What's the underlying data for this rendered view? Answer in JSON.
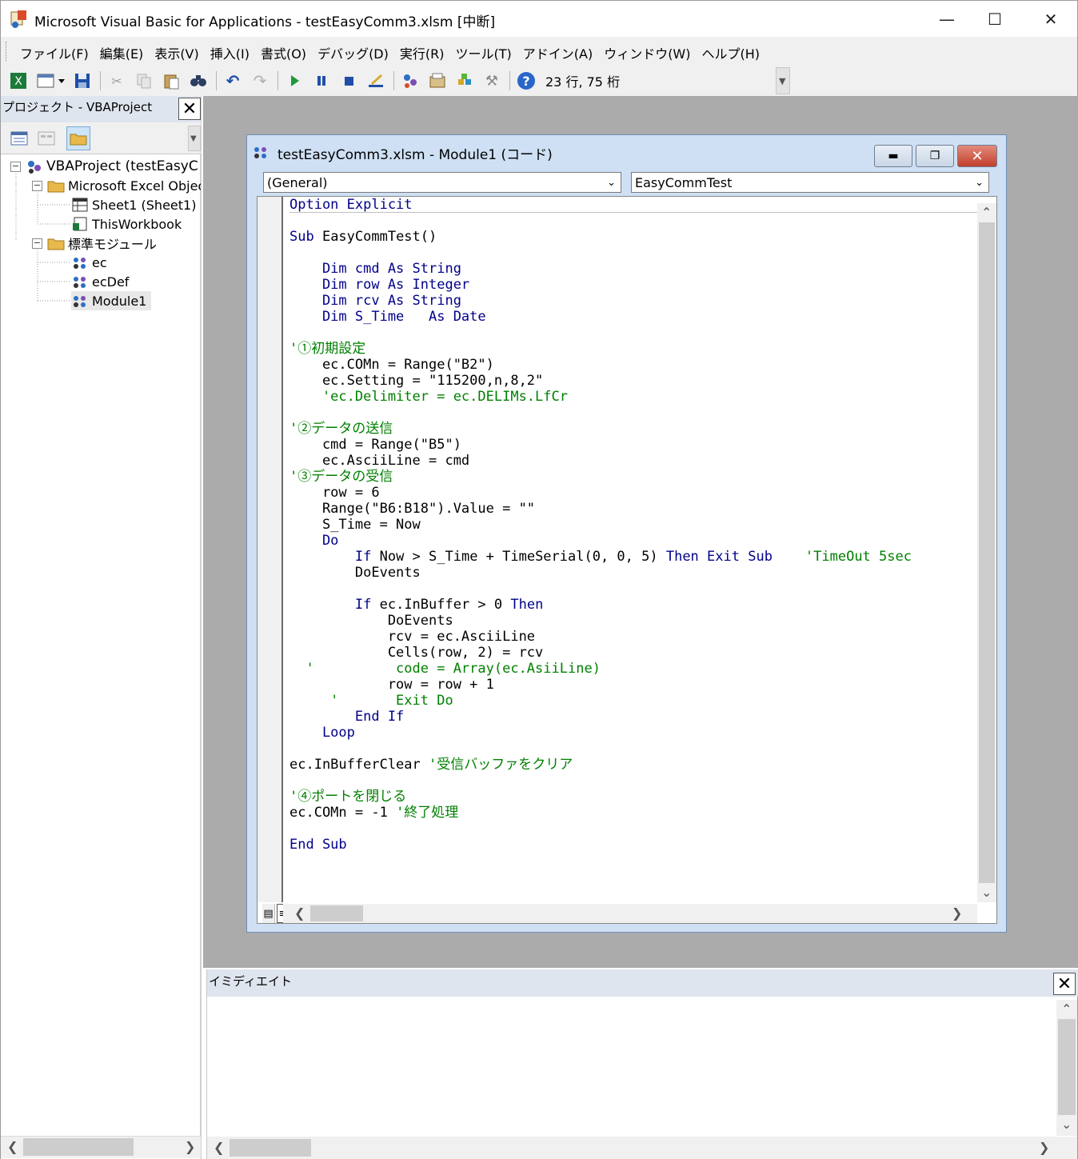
{
  "window": {
    "title": "Microsoft Visual Basic for Applications - testEasyComm3.xlsm [中断]",
    "minimize_icon": "minimize-icon",
    "maximize_icon": "maximize-icon",
    "close_icon": "close-icon"
  },
  "menubar": {
    "items": [
      {
        "label": "ファイル(F)"
      },
      {
        "label": "編集(E)"
      },
      {
        "label": "表示(V)"
      },
      {
        "label": "挿入(I)"
      },
      {
        "label": "書式(O)"
      },
      {
        "label": "デバッグ(D)"
      },
      {
        "label": "実行(R)"
      },
      {
        "label": "ツール(T)"
      },
      {
        "label": "アドイン(A)"
      },
      {
        "label": "ウィンドウ(W)"
      },
      {
        "label": "ヘルプ(H)"
      }
    ]
  },
  "toolbar": {
    "icons": [
      "excel-view-icon",
      "insert-module-icon",
      "save-icon",
      "cut-icon",
      "copy-icon",
      "paste-icon",
      "find-icon",
      "undo-icon",
      "redo-icon",
      "run-icon",
      "break-icon",
      "reset-icon",
      "design-mode-icon",
      "project-explorer-icon",
      "properties-icon",
      "object-browser-icon",
      "toolbox-icon",
      "help-icon"
    ],
    "cursor_position": "23 行, 75 桁"
  },
  "project": {
    "title": "プロジェクト - VBAProject",
    "tree": {
      "root": "VBAProject (testEasyC",
      "excel_objects": "Microsoft Excel Objec",
      "sheet1": "Sheet1 (Sheet1)",
      "thisworkbook": "ThisWorkbook",
      "modules_folder": "標準モジュール",
      "modules": [
        "ec",
        "ecDef",
        "Module1"
      ]
    }
  },
  "code_window": {
    "title": "testEasyComm3.xlsm - Module1 (コード)",
    "object_combo": "(General)",
    "procedure_combo": "EasyCommTest",
    "lines": [
      {
        "text": "Option Explicit",
        "kind": "kw"
      },
      {
        "text": "",
        "kind": "plain"
      },
      {
        "text": "Sub EasyCommTest()",
        "kind": "mixed_sub"
      },
      {
        "text": "",
        "kind": "plain"
      },
      {
        "text": "    Dim cmd As String",
        "kind": "kw"
      },
      {
        "text": "    Dim row As Integer",
        "kind": "kw"
      },
      {
        "text": "    Dim rcv As String",
        "kind": "kw"
      },
      {
        "text": "    Dim S_Time   As Date",
        "kind": "kw"
      },
      {
        "text": "",
        "kind": "plain"
      },
      {
        "text": "'①初期設定",
        "kind": "cm"
      },
      {
        "text": "    ec.COMn = Range(\"B2\")",
        "kind": "plain"
      },
      {
        "text": "    ec.Setting = \"115200,n,8,2\"",
        "kind": "plain"
      },
      {
        "text": "    'ec.Delimiter = ec.DELIMs.LfCr",
        "kind": "cm"
      },
      {
        "text": "",
        "kind": "plain"
      },
      {
        "text": "'②データの送信",
        "kind": "cm"
      },
      {
        "text": "    cmd = Range(\"B5\")",
        "kind": "plain"
      },
      {
        "text": "    ec.AsciiLine = cmd",
        "kind": "plain"
      },
      {
        "text": "'③データの受信",
        "kind": "cm"
      },
      {
        "text": "    row = 6",
        "kind": "plain"
      },
      {
        "text": "    Range(\"B6:B18\").Value = \"\"",
        "kind": "plain"
      },
      {
        "text": "    S_Time = Now",
        "kind": "plain"
      },
      {
        "text": "    Do",
        "kind": "kw"
      },
      {
        "text": "        If Now > S_Time + TimeSerial(0, 0, 5) Then Exit Sub",
        "kind": "mixed_if",
        "comment": "    'TimeOut 5sec"
      },
      {
        "text": "        DoEvents",
        "kind": "plain"
      },
      {
        "text": "",
        "kind": "plain"
      },
      {
        "text": "        If ec.InBuffer > 0 Then",
        "kind": "mixed_if2"
      },
      {
        "text": "            DoEvents",
        "kind": "plain"
      },
      {
        "text": "            rcv = ec.AsciiLine",
        "kind": "plain"
      },
      {
        "text": "            Cells(row, 2) = rcv",
        "kind": "plain"
      },
      {
        "text": "  '          code = Array(ec.AsiiLine)",
        "kind": "cm"
      },
      {
        "text": "            row = row + 1",
        "kind": "plain"
      },
      {
        "text": "     '       Exit Do",
        "kind": "cm"
      },
      {
        "text": "        End If",
        "kind": "kw"
      },
      {
        "text": "    Loop",
        "kind": "kw"
      },
      {
        "text": "",
        "kind": "plain"
      },
      {
        "text": "ec.InBufferClear",
        "kind": "mixed_cm",
        "comment": " '受信バッファをクリア"
      },
      {
        "text": "",
        "kind": "plain"
      },
      {
        "text": "'④ポートを閉じる",
        "kind": "cm"
      },
      {
        "text": "ec.COMn = -1",
        "kind": "mixed_cm",
        "comment": " '終了処理"
      },
      {
        "text": "",
        "kind": "plain"
      },
      {
        "text": "End Sub",
        "kind": "kw"
      }
    ]
  },
  "immediate": {
    "title": "イミディエイト"
  }
}
